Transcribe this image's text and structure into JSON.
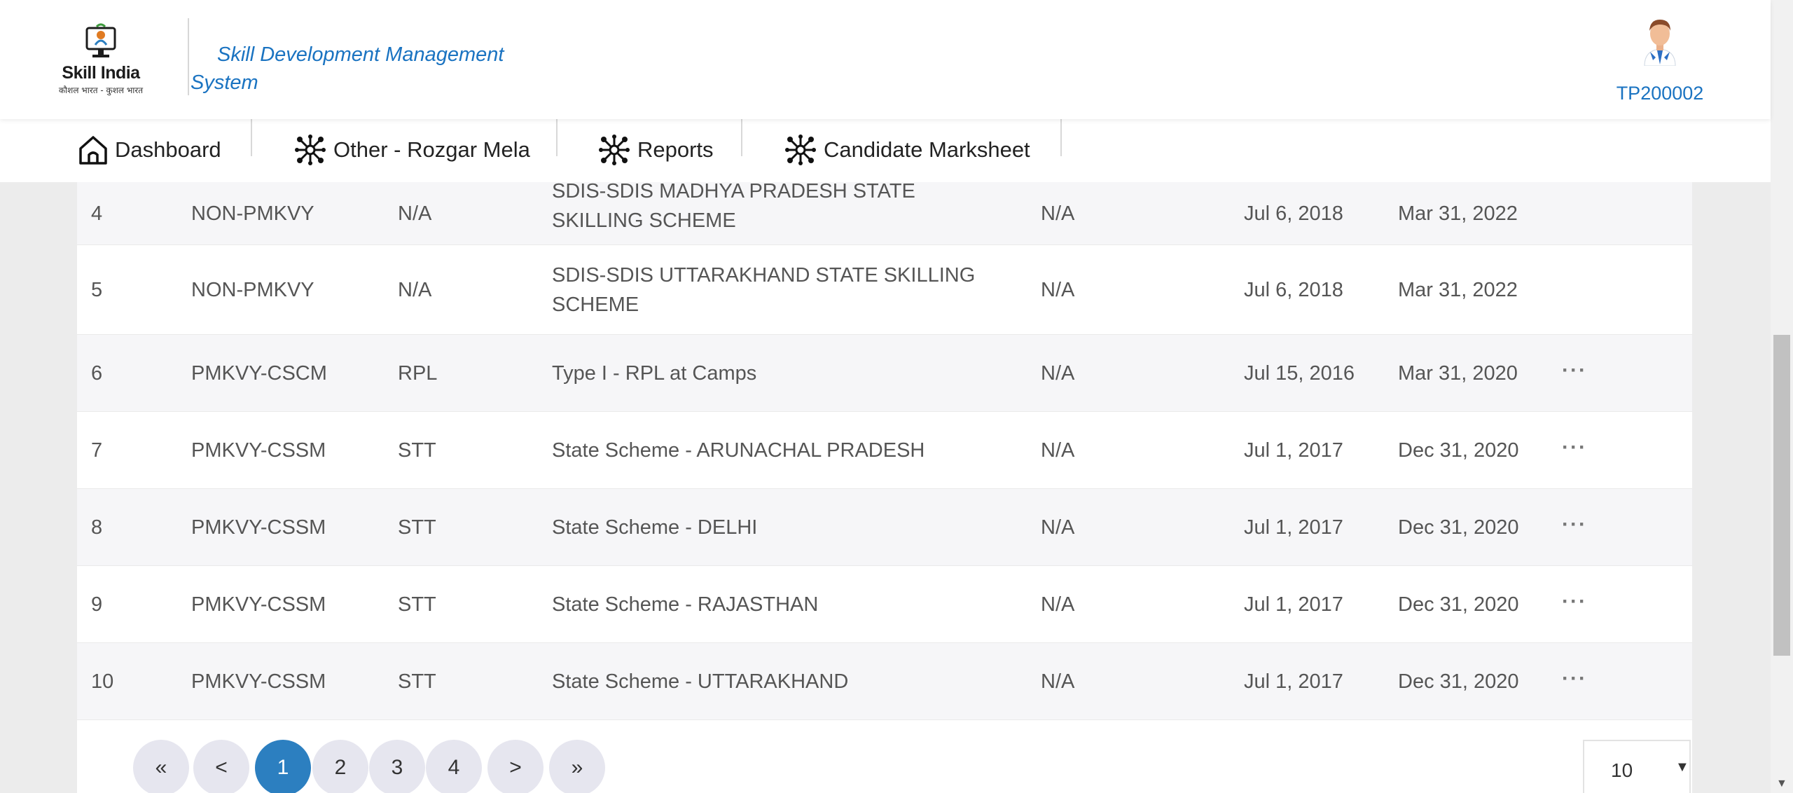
{
  "header": {
    "logo_text": "Skill India",
    "logo_tagline": "कौशल भारत - कुशल भारत",
    "system_title": "Skill Development Management System",
    "user_id": "TP200002"
  },
  "nav": {
    "items": [
      {
        "label": "Dashboard",
        "icon": "home-icon"
      },
      {
        "label": "Other - Rozgar Mela",
        "icon": "network-icon"
      },
      {
        "label": "Reports",
        "icon": "network-icon"
      },
      {
        "label": "Candidate Marksheet",
        "icon": "network-icon"
      }
    ]
  },
  "table": {
    "rows": [
      {
        "no": "4",
        "scheme_type": "NON-PMKVY",
        "category": "N/A",
        "name": "SDIS-SDIS MADHYA PRADESH STATE SKILLING SCHEME",
        "col5": "N/A",
        "start": "Jul 6, 2018",
        "end": "Mar 31, 2022",
        "actions": ""
      },
      {
        "no": "5",
        "scheme_type": "NON-PMKVY",
        "category": "N/A",
        "name": "SDIS-SDIS UTTARAKHAND STATE SKILLING SCHEME",
        "col5": "N/A",
        "start": "Jul 6, 2018",
        "end": "Mar 31, 2022",
        "actions": ""
      },
      {
        "no": "6",
        "scheme_type": "PMKVY-CSCM",
        "category": "RPL",
        "name": "Type I - RPL at Camps",
        "col5": "N/A",
        "start": "Jul 15, 2016",
        "end": "Mar 31, 2020",
        "actions": "···"
      },
      {
        "no": "7",
        "scheme_type": "PMKVY-CSSM",
        "category": "STT",
        "name": "State Scheme - ARUNACHAL PRADESH",
        "col5": "N/A",
        "start": "Jul 1, 2017",
        "end": "Dec 31, 2020",
        "actions": "···"
      },
      {
        "no": "8",
        "scheme_type": "PMKVY-CSSM",
        "category": "STT",
        "name": "State Scheme - DELHI",
        "col5": "N/A",
        "start": "Jul 1, 2017",
        "end": "Dec 31, 2020",
        "actions": "···"
      },
      {
        "no": "9",
        "scheme_type": "PMKVY-CSSM",
        "category": "STT",
        "name": "State Scheme - RAJASTHAN",
        "col5": "N/A",
        "start": "Jul 1, 2017",
        "end": "Dec 31, 2020",
        "actions": "···"
      },
      {
        "no": "10",
        "scheme_type": "PMKVY-CSSM",
        "category": "STT",
        "name": "State Scheme - UTTARAKHAND",
        "col5": "N/A",
        "start": "Jul 1, 2017",
        "end": "Dec 31, 2020",
        "actions": "···"
      }
    ]
  },
  "pagination": {
    "first": "«",
    "prev": "<",
    "pages": [
      "1",
      "2",
      "3",
      "4"
    ],
    "current_page": "1",
    "next": ">",
    "last": "»",
    "page_size": "10"
  },
  "colors": {
    "accent": "#2c7fc0",
    "title_blue": "#1a73c1"
  }
}
